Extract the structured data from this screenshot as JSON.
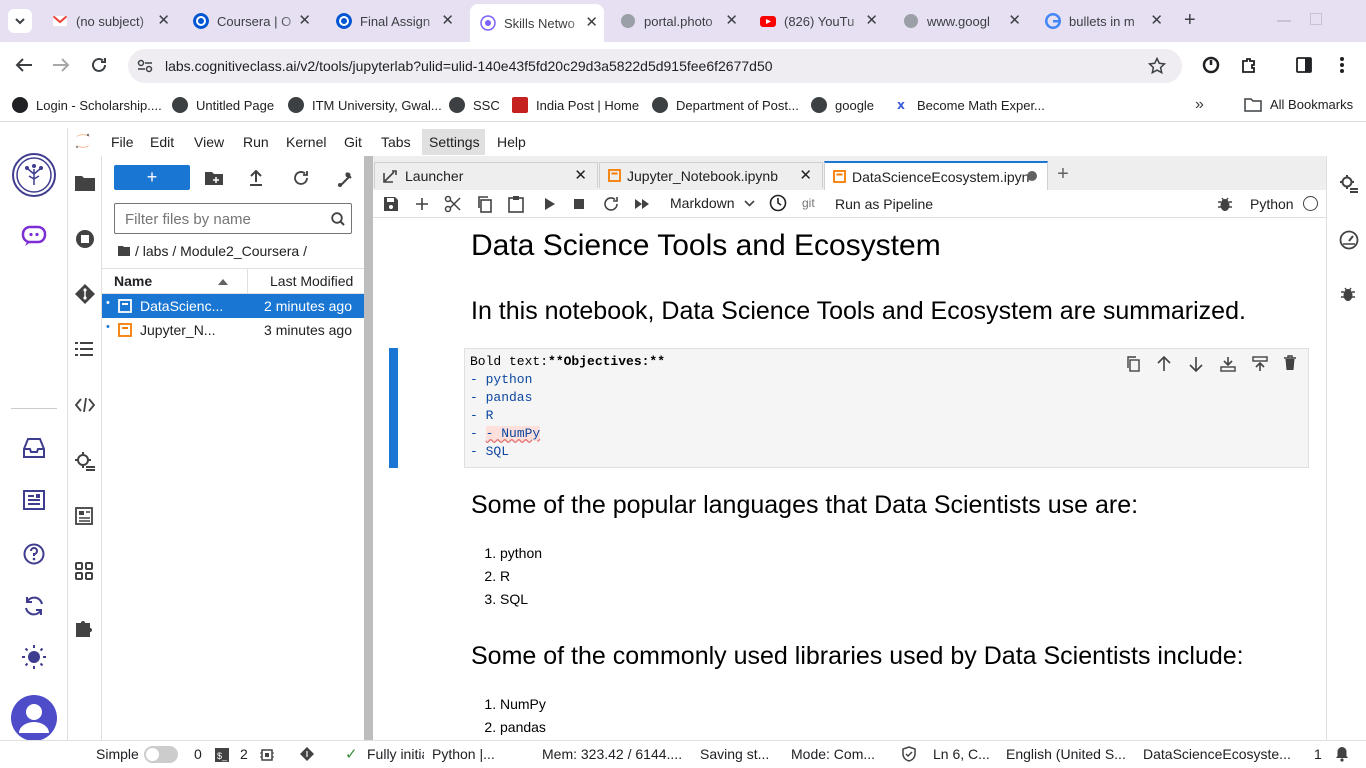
{
  "browser": {
    "tabs": [
      {
        "title": "(no subject)",
        "icon": "gmail-icon"
      },
      {
        "title": "Coursera | O",
        "icon": "coursera-icon"
      },
      {
        "title": "Final Assign",
        "icon": "coursera-icon"
      },
      {
        "title": "Skills Netwo",
        "icon": "skills-network-icon"
      },
      {
        "title": "portal.photo",
        "icon": "globe-icon"
      },
      {
        "title": "(826) YouTu",
        "icon": "youtube-icon"
      },
      {
        "title": "www.googl",
        "icon": "globe-icon"
      },
      {
        "title": "bullets in m",
        "icon": "google-icon"
      }
    ],
    "active_tab_index": 3,
    "url": "labs.cognitiveclass.ai/v2/tools/jupyterlab?ulid=ulid-140e43f5fd20c29d3a5822d5d915fee6f2677d50",
    "bookmarks": [
      "Login - Scholarship....",
      "Untitled Page",
      "ITM University, Gwal...",
      "SSC",
      "India Post | Home",
      "Department of Post...",
      "google",
      "Become Math Exper..."
    ],
    "all_bookmarks": "All Bookmarks"
  },
  "jupyter": {
    "menu": [
      "File",
      "Edit",
      "View",
      "Run",
      "Kernel",
      "Git",
      "Tabs",
      "Settings",
      "Help"
    ],
    "new_button": "+",
    "filter_placeholder": "Filter files by name",
    "breadcrumb": "/ labs / Module2_Coursera /",
    "file_headers": {
      "name": "Name",
      "modified": "Last Modified"
    },
    "files": [
      {
        "name": "DataScienc...",
        "modified": "2 minutes ago",
        "selected": true
      },
      {
        "name": "Jupyter_N...",
        "modified": "3 minutes ago",
        "selected": false
      }
    ],
    "doc_tabs": [
      {
        "label": "Launcher",
        "icon": "launcher-icon"
      },
      {
        "label": "Jupyter_Notebook.ipynb",
        "icon": "notebook-icon"
      },
      {
        "label": "DataScienceEcosystem.ipyn",
        "icon": "notebook-icon",
        "active": true,
        "unsaved": true
      }
    ],
    "toolbar": {
      "cell_type": "Markdown",
      "git": "git",
      "run_pipeline": "Run as Pipeline",
      "kernel": "Python"
    },
    "notebook": {
      "title": "Data Science Tools and Ecosystem",
      "intro": "In this notebook, Data Science Tools and Ecosystem are summarized.",
      "edit_cell": {
        "prefix": "Bold text:",
        "bold": "**Objectives:**",
        "lines": [
          "- python",
          "- pandas",
          "- R",
          "- NumPy",
          "- SQL"
        ]
      },
      "languages_heading": "Some of the popular languages that Data Scientists use are:",
      "languages": [
        "python",
        "R",
        "SQL"
      ],
      "libraries_heading": "Some of the commonly used libraries used by Data Scientists include:",
      "libraries": [
        "NumPy",
        "pandas"
      ]
    },
    "status": {
      "mode_label": "Simple",
      "num_a": "0",
      "num_b": "2",
      "init": "Fully initialized",
      "kernel": "Python |...",
      "mem": "Mem: 323.42 / 6144....",
      "saving": "Saving st...",
      "mode": "Mode: Com...",
      "cursor": "Ln 6, C...",
      "lang": "English (United S...",
      "file": "DataScienceEcosyste...",
      "count": "1"
    }
  },
  "colors": {
    "accent": "#1976d2",
    "tabstrip": "#e7e0f3",
    "omnibox": "#efedf1",
    "splitter": "#bdbdbd",
    "notebook_orange": "#f57c00"
  }
}
